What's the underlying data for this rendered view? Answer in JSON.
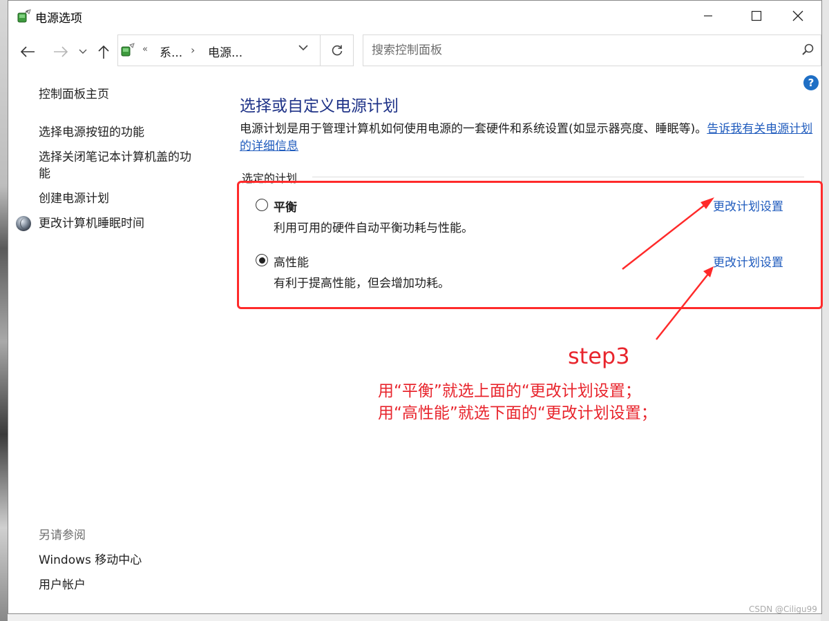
{
  "window": {
    "title": "电源选项",
    "minimize_glyph": "—",
    "close_glyph": "✕"
  },
  "nav": {
    "back_icon": "back-arrow-icon",
    "forward_icon": "forward-arrow-icon",
    "recent_icon": "chevron-down-icon",
    "up_icon": "up-arrow-icon"
  },
  "address": {
    "overflow": "«",
    "crumbs": [
      "系...",
      "电源..."
    ],
    "separator": "›"
  },
  "search": {
    "placeholder": "搜索控制面板"
  },
  "left_pane": {
    "home": "控制面板主页",
    "links": [
      "选择电源按钮的功能",
      "选择关闭笔记本计算机盖的功\n能",
      "创建电源计划",
      "更改计算机睡眠时间"
    ],
    "see_also_label": "另请参阅",
    "see_also": [
      "Windows 移动中心",
      "用户帐户"
    ]
  },
  "main": {
    "title": "选择或自定义电源计划",
    "description": "电源计划是用于管理计算机如何使用电源的一套硬件和系统设置(如显示器亮度、睡眠等)。",
    "description_link": "告诉我有关电源计划的详细信息",
    "group_label": "选定的计划",
    "plans": [
      {
        "name": "平衡",
        "description": "利用可用的硬件自动平衡功耗与性能。",
        "selected": false,
        "link": "更改计划设置"
      },
      {
        "name": "高性能",
        "description": "有利于提高性能，但会增加功耗。",
        "selected": true,
        "link": "更改计划设置"
      }
    ]
  },
  "annotation": {
    "step": "step3",
    "lines": [
      "用“平衡”就选上面的“更改计划设置；",
      "用“高性能”就选下面的“更改计划设置；"
    ],
    "color": "#e8252d"
  },
  "watermark": "CSDN @Ciligu99",
  "colors": {
    "title_blue": "#1e3287",
    "link_blue": "#1f5bbd",
    "annotation_red": "#ff2a2a"
  }
}
